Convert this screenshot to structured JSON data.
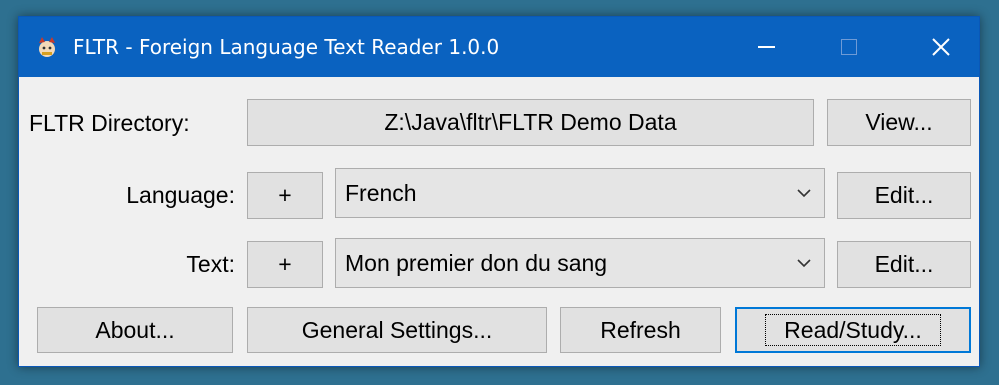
{
  "window": {
    "title": "FLTR - Foreign Language Text Reader 1.0.0",
    "title_bar_color": "#0a62c0"
  },
  "directory": {
    "label": "FLTR Directory:",
    "path": "Z:\\Java\\fltr\\FLTR Demo Data",
    "view_label": "View..."
  },
  "language": {
    "label": "Language:",
    "add_label": "+",
    "selected": "French",
    "edit_label": "Edit..."
  },
  "text": {
    "label": "Text:",
    "add_label": "+",
    "selected": "Mon premier don du sang",
    "edit_label": "Edit..."
  },
  "actions": {
    "about": "About...",
    "general_settings": "General Settings...",
    "refresh": "Refresh",
    "read_study": "Read/Study..."
  },
  "icons": {
    "app": "fltr-app-icon",
    "minimize": "minimize-icon",
    "maximize": "maximize-icon",
    "close": "close-icon",
    "dropdown": "chevron-down-icon"
  }
}
